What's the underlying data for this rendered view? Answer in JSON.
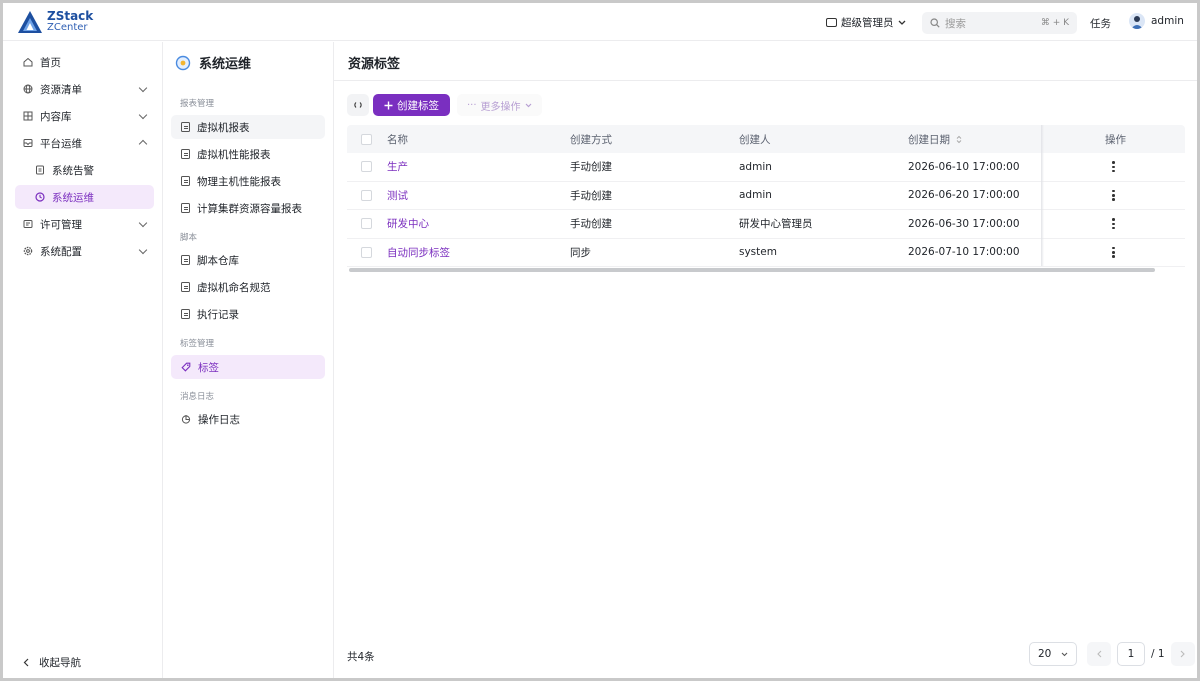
{
  "brand": {
    "line1": "ZStack",
    "line2": "ZCenter"
  },
  "header": {
    "role": "超级管理员",
    "search_placeholder": "搜索",
    "search_shortcut": "⌘ + K",
    "tasks": "任务",
    "user": "admin"
  },
  "leftnav": {
    "items": [
      {
        "label": "首页",
        "icon": "home-icon"
      },
      {
        "label": "资源清单",
        "icon": "globe-icon"
      },
      {
        "label": "内容库",
        "icon": "library-icon"
      },
      {
        "label": "平台运维",
        "icon": "ops-icon"
      },
      {
        "label": "系统告警",
        "icon": "document-icon"
      },
      {
        "label": "系统运维",
        "icon": "clock-icon"
      },
      {
        "label": "许可管理",
        "icon": "license-icon"
      },
      {
        "label": "系统配置",
        "icon": "gear-icon"
      }
    ],
    "collapse_label": "收起导航"
  },
  "subnav": {
    "title": "系统运维",
    "groups": [
      {
        "label": "报表管理",
        "items": [
          "虚拟机报表",
          "虚拟机性能报表",
          "物理主机性能报表",
          "计算集群资源容量报表"
        ]
      },
      {
        "label": "脚本",
        "items": [
          "脚本仓库",
          "虚拟机命名规范",
          "执行记录"
        ]
      },
      {
        "label": "标签管理",
        "items": [
          "标签"
        ]
      },
      {
        "label": "消息日志",
        "items": [
          "操作日志"
        ]
      }
    ]
  },
  "main": {
    "title": "资源标签",
    "toolbar": {
      "refresh": "↻",
      "create": "创建标签",
      "more": "更多操作"
    },
    "columns": [
      "名称",
      "创建方式",
      "创建人",
      "创建日期",
      "操作"
    ],
    "rows": [
      {
        "name": "生产",
        "method": "手动创建",
        "creator": "admin",
        "date": "2026-06-10 17:00:00"
      },
      {
        "name": "测试",
        "method": "手动创建",
        "creator": "admin",
        "date": "2026-06-20 17:00:00"
      },
      {
        "name": "研发中心",
        "method": "手动创建",
        "creator": "研发中心管理员",
        "date": "2026-06-30 17:00:00"
      },
      {
        "name": "自动同步标签",
        "method": "同步",
        "creator": "system",
        "date": "2026-07-10 17:00:00"
      }
    ],
    "total": "共4条",
    "pagination": {
      "page_size": "20",
      "current_page": "1",
      "total_pages": "/ 1"
    }
  },
  "colors": {
    "accent": "#7a2fc0",
    "active_bg": "#f4e9fb",
    "brand_blue": "#1d4fa0"
  }
}
